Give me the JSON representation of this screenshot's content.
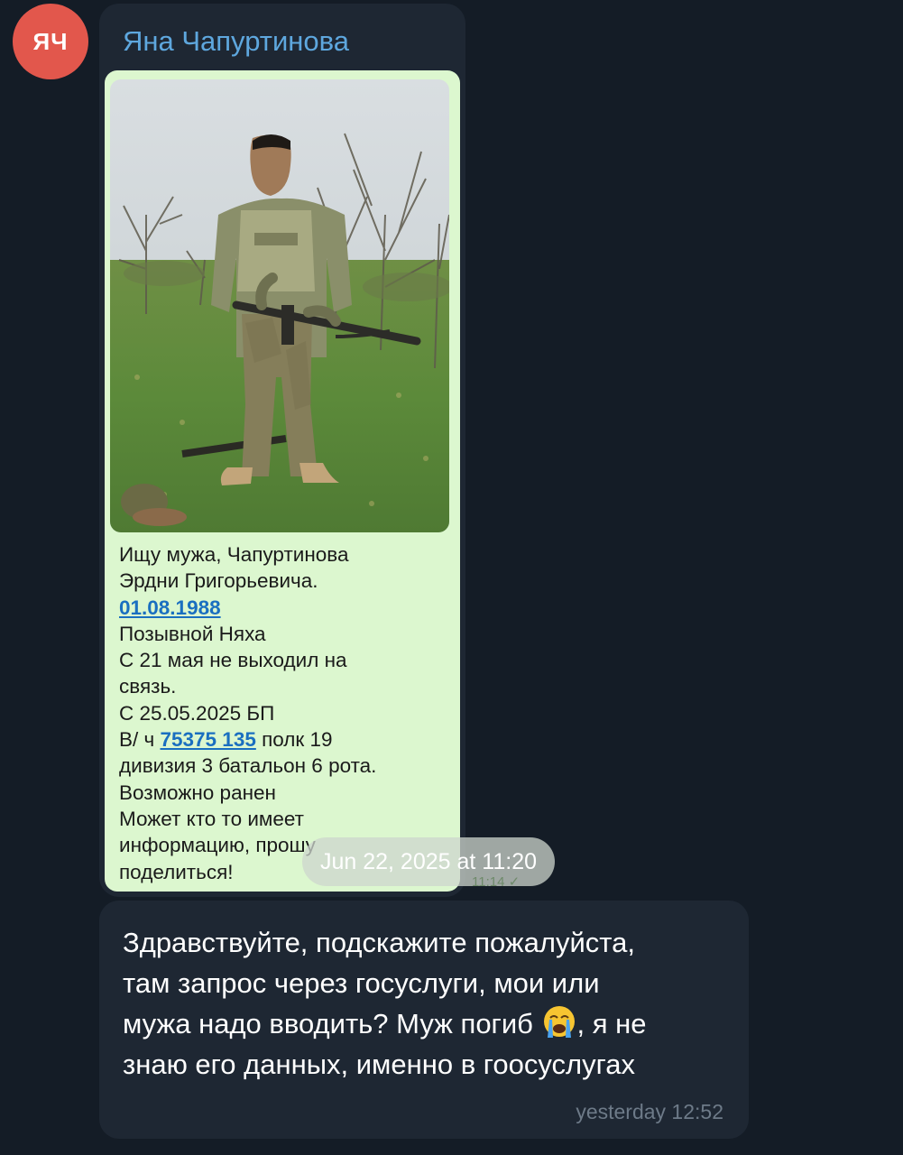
{
  "sender": {
    "avatar_initials": "ЯЧ",
    "avatar_color": "#e2574c",
    "name": "Яна Чапуртинова",
    "name_color": "#5ea7de"
  },
  "forwarded_post": {
    "photo_icon": "soldier-photo",
    "text_lines": {
      "l1": "Ищу мужа, Чапуртинова",
      "l2": "Эрдни Григорьевича.",
      "l3_link": "01.08.1988",
      "l4": "Позывной Няха",
      "l5": "С 21 мая не выходил на",
      "l6": "связь.",
      "l7": "С 25.05.2025 БП",
      "l8_prefix": "В/ ч ",
      "l8_link": "75375 135",
      "l8_suffix": " полк 19",
      "l9": "дивизия 3 батальон 6 рота.",
      "l10": "Возможно ранен",
      "l11": "Может кто то имеет",
      "l12": "информацию, прошу",
      "l13": "поделиться!"
    },
    "date_overlay": "Jun 22, 2025 at 11:20",
    "time": "11:14 ✓",
    "card_color": "#dcf7cf",
    "link_color": "#1a6fc0"
  },
  "reply_message": {
    "line1": "Здравствуйте, подскажите пожалуйста,",
    "line2": "там запрос через  госуслуги, мои или",
    "line3_before_emoji": "мужа надо вводить? Муж погиб ",
    "emoji": "crying-face",
    "line3_after_emoji": ", я не",
    "line4": "знаю его данных, именно в гоосуслугах",
    "time": "yesterday 12:52"
  },
  "colors": {
    "background": "#141c26",
    "bubble": "#1e2733"
  }
}
